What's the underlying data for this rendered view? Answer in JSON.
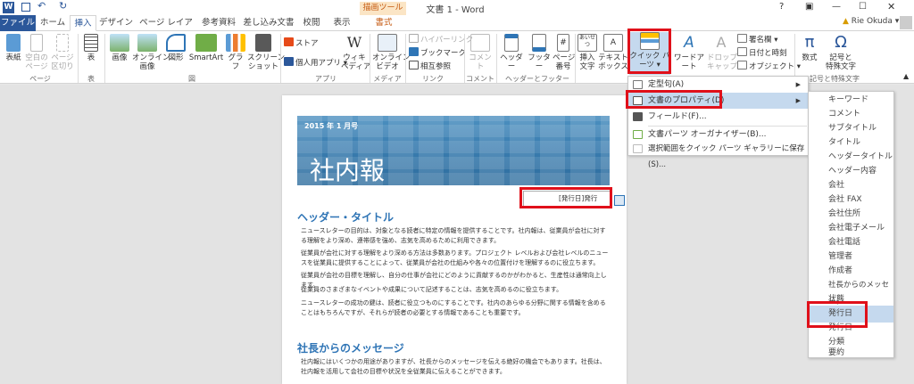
{
  "title": {
    "doc": "文書 1 - Word",
    "context": "描画ツール",
    "user": "Rie Okuda"
  },
  "tabs": [
    "ファイル",
    "ホーム",
    "挿入",
    "デザイン",
    "ページ レイアウト",
    "参考資料",
    "差し込み文書",
    "校閲",
    "表示",
    "書式"
  ],
  "groups": [
    "ページ",
    "表",
    "図",
    "アプリ",
    "メディア",
    "リンク",
    "コメント",
    "ヘッダーとフッター",
    "記号と特殊文字"
  ],
  "buttons": {
    "cover": "表紙",
    "blank": "空白の\nページ",
    "pagebreak": "ページ\n区切り",
    "table": "表",
    "picture": "画像",
    "online_picture": "オンライン\n画像",
    "shapes": "図形",
    "smartart": "SmartArt",
    "chart": "グラフ",
    "screenshot": "スクリーン\nショット",
    "store": "ストア",
    "myapps": "個人用アプリ",
    "wiki": "ウィキ\nペディア",
    "video": "オンライン\nビデオ",
    "hyperlink": "ハイパーリンク",
    "bookmark": "ブックマーク",
    "crossref": "相互参照",
    "comment": "コメント",
    "header": "ヘッダー",
    "footer": "フッター",
    "pagenum": "ページ\n番号",
    "textbox_ins": "挿入\n文字",
    "textbox": "テキスト\nボックス",
    "quickparts": "クイック パーツ",
    "wordart": "ワードアート",
    "dropcap": "ドロップ\nキャップ",
    "signature": "署名欄",
    "datetime": "日付と時刻",
    "object": "オブジェクト",
    "equation": "数式",
    "symbol": "記号と\n特殊文字"
  },
  "menu": [
    {
      "label": "定型句(A)",
      "arrow": "▶"
    },
    {
      "label": "文書のプロパティ(D)",
      "arrow": "▶"
    },
    {
      "label": "フィールド(F)..."
    },
    {
      "label": "文書パーツ オーガナイザー(B)..."
    },
    {
      "label": "選択範囲をクイック パーツ ギャラリーに保存(S)..."
    }
  ],
  "submenu": [
    "キーワード",
    "コメント",
    "サブタイトル",
    "タイトル",
    "ヘッダータイトル",
    "ヘッダー内容",
    "会社",
    "会社 FAX",
    "会社住所",
    "会社電子メール",
    "会社電話",
    "管理者",
    "作成者",
    "社長からのメッセージ",
    "状態",
    "発行日",
    "発行日",
    "分類",
    "要約"
  ],
  "doc": {
    "date": "2015 年 1 月号",
    "banner_title": "社内報",
    "pubdate_field": "[発行日]発行",
    "heading1": "ヘッダー・タイトル",
    "p1": "ニュースレターの目的は、対象となる読者に特定の情報を提供することです。社内報は、従業員が会社に対する理解をより深め、連帯感を強め、志気を高めるために利用できます。",
    "p2": "従業員が会社に対する理解をより深める方法は多数あります。プロジェクト レベルおよび会社レベルのニュースを従業員に提供することによって、従業員が会社の仕組みや各々の位置付けを理解するのに役立ちます。",
    "p3": "従業員が会社の目標を理解し、自分の仕事が会社にどのように貢献するのかがわかると、生産性は通常向上します。",
    "p4": "従業員のさまざまなイベントや成果について記述することは、志気を高めるのに役立ちます。",
    "p5": "ニュースレターの成功の鍵は、読者に役立つものにすることです。社内のあらゆる分野に関する情報を含めることはもちろんですが、それらが読者の必要とする情報であることも重要です。",
    "heading2": "社長からのメッセージ",
    "p6": "社内報にはいくつかの用途がありますが、社長からのメッセージを伝える絶好の機会でもあります。社長は、社内報を活用して会社の目標や状況を全従業員に伝えることができます。"
  },
  "colors": {
    "accent": "#2b579a",
    "highlight": "#e0101a",
    "context_tab": "#f5a623"
  }
}
